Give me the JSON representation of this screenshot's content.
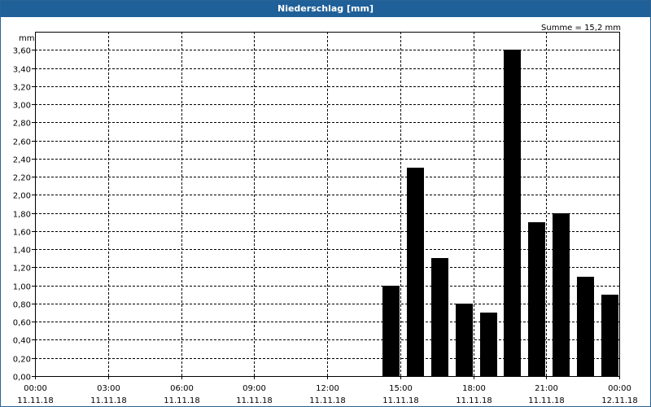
{
  "window": {
    "title": "Niederschlag [mm]"
  },
  "colors": {
    "titlebar": "#1f6099",
    "bars": "#000000",
    "grid": "#000000"
  },
  "chart_data": {
    "type": "bar",
    "title": "Niederschlag [mm]",
    "ylabel": "mm",
    "sum_label": "Summe = 15,2 mm",
    "ylim": [
      0,
      3.8
    ],
    "yticks": [
      "0,00",
      "0,20",
      "0,40",
      "0,60",
      "0,80",
      "1,00",
      "1,20",
      "1,40",
      "1,60",
      "1,80",
      "2,00",
      "2,20",
      "2,40",
      "2,60",
      "2,80",
      "3,00",
      "3,20",
      "3,40",
      "3,60"
    ],
    "xlim": [
      0,
      24
    ],
    "xticks": [
      {
        "time": "00:00",
        "date": "11.11.18"
      },
      {
        "time": "03:00",
        "date": "11.11.18"
      },
      {
        "time": "06:00",
        "date": "11.11.18"
      },
      {
        "time": "09:00",
        "date": "11.11.18"
      },
      {
        "time": "12:00",
        "date": "11.11.18"
      },
      {
        "time": "15:00",
        "date": "11.11.18"
      },
      {
        "time": "18:00",
        "date": "11.11.18"
      },
      {
        "time": "21:00",
        "date": "11.11.18"
      },
      {
        "time": "00:00",
        "date": "12.11.18"
      }
    ],
    "bars": [
      {
        "start": 14,
        "end": 15,
        "value": 1.0
      },
      {
        "start": 15,
        "end": 16,
        "value": 2.3
      },
      {
        "start": 16,
        "end": 17,
        "value": 1.3
      },
      {
        "start": 17,
        "end": 18,
        "value": 0.8
      },
      {
        "start": 18,
        "end": 19,
        "value": 0.7
      },
      {
        "start": 19,
        "end": 20,
        "value": 3.6
      },
      {
        "start": 20,
        "end": 21,
        "value": 1.7
      },
      {
        "start": 21,
        "end": 22,
        "value": 1.8
      },
      {
        "start": 22,
        "end": 23,
        "value": 1.1
      },
      {
        "start": 23,
        "end": 24,
        "value": 0.9
      }
    ],
    "grid": true
  }
}
